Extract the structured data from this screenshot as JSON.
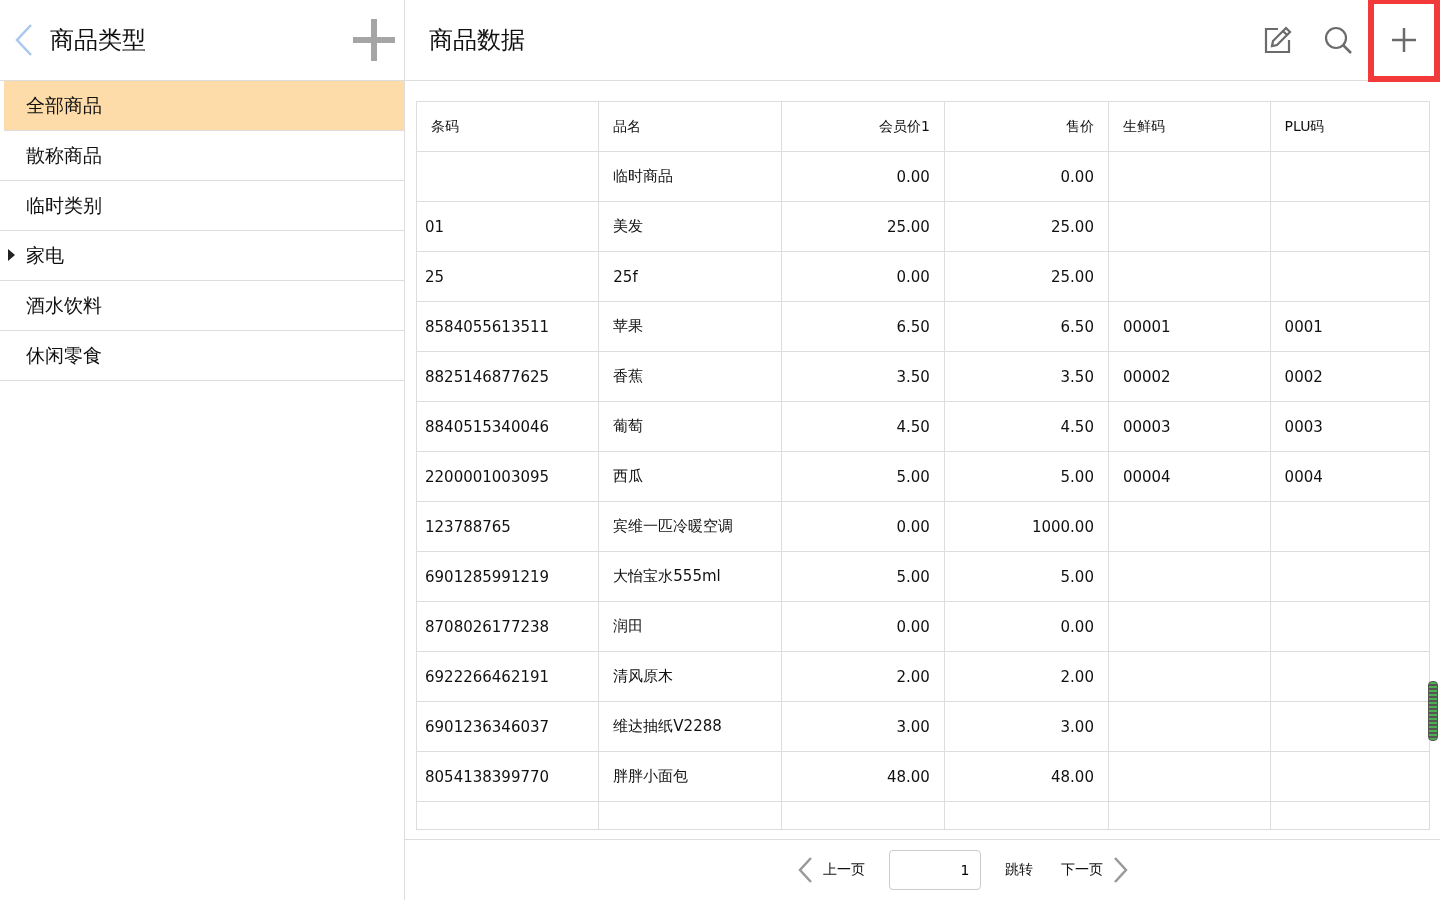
{
  "sidebar": {
    "title": "商品类型",
    "items": [
      {
        "label": "全部商品",
        "selected": true,
        "has_children": false
      },
      {
        "label": "散称商品",
        "selected": false,
        "has_children": false
      },
      {
        "label": "临时类别",
        "selected": false,
        "has_children": false
      },
      {
        "label": "家电",
        "selected": false,
        "has_children": true
      },
      {
        "label": "酒水饮料",
        "selected": false,
        "has_children": false
      },
      {
        "label": "休闲零食",
        "selected": false,
        "has_children": false
      }
    ]
  },
  "main": {
    "title": "商品数据",
    "toolbar": [
      {
        "kind": "edit",
        "highlighted": false
      },
      {
        "kind": "search",
        "highlighted": false
      },
      {
        "kind": "add",
        "highlighted": true
      }
    ]
  },
  "table": {
    "columns": [
      {
        "label": "条码",
        "kind": "text"
      },
      {
        "label": "品名",
        "kind": "text"
      },
      {
        "label": "会员价1",
        "kind": "number"
      },
      {
        "label": "售价",
        "kind": "number"
      },
      {
        "label": "生鲜码",
        "kind": "text"
      },
      {
        "label": "PLU码",
        "kind": "text"
      }
    ],
    "rows": [
      [
        "",
        "临时商品",
        "0.00",
        "0.00",
        "",
        ""
      ],
      [
        "01",
        "美发",
        "25.00",
        "25.00",
        "",
        ""
      ],
      [
        "25",
        "25f",
        "0.00",
        "25.00",
        "",
        ""
      ],
      [
        "8584055613511",
        "苹果",
        "6.50",
        "6.50",
        "00001",
        "0001"
      ],
      [
        "8825146877625",
        "香蕉",
        "3.50",
        "3.50",
        "00002",
        "0002"
      ],
      [
        "8840515340046",
        "葡萄",
        "4.50",
        "4.50",
        "00003",
        "0003"
      ],
      [
        "2200001003095",
        "西瓜",
        "5.00",
        "5.00",
        "00004",
        "0004"
      ],
      [
        "123788765",
        "宾维一匹冷暖空调",
        "0.00",
        "1000.00",
        "",
        ""
      ],
      [
        "6901285991219",
        "大怡宝水555ml",
        "5.00",
        "5.00",
        "",
        ""
      ],
      [
        "8708026177238",
        "润田",
        "0.00",
        "0.00",
        "",
        ""
      ],
      [
        "6922266462191",
        "清风原木",
        "2.00",
        "2.00",
        "",
        ""
      ],
      [
        "6901236346037",
        "维达抽纸V2288",
        "3.00",
        "3.00",
        "",
        ""
      ],
      [
        "8054138399770",
        "胖胖小面包",
        "48.00",
        "48.00",
        "",
        ""
      ]
    ]
  },
  "pagination": {
    "previous": "上一页",
    "page": "1",
    "jump": "跳转",
    "next": "下一页"
  }
}
